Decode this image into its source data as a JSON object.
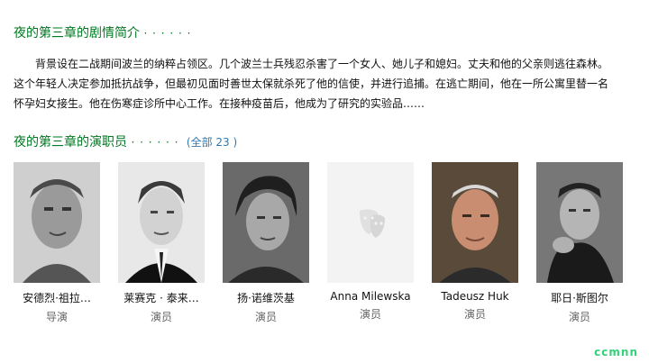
{
  "plot_section": {
    "title": "夜的第三章的剧情简介",
    "dots": "· · · · · ·",
    "summary": "背景设在二战期间波兰的纳粹占领区。几个波兰士兵残忍杀害了一个女人、她儿子和媳妇。丈夫和他的父亲则逃往森林。这个年轻人决定参加抵抗战争，但最初见面时善世太保就杀死了他的信使，并进行追捕。在逃亡期间，他在一所公寓里替一名怀孕妇女接生。他在伤寒症诊所中心工作。在接种疫苗后，他成为了研究的实验品……"
  },
  "cast_section": {
    "title": "夜的第三章的演职员",
    "dots": "· · · · · ·",
    "count_open": "(",
    "count_text": "全部 23",
    "count_close": ")",
    "members": [
      {
        "name": "安德烈·祖拉…",
        "role": "导演"
      },
      {
        "name": "莱赛克 · 泰来…",
        "role": "演员"
      },
      {
        "name": "扬·诺维茨基",
        "role": "演员"
      },
      {
        "name": "Anna Milewska",
        "role": "演员",
        "photo": "placeholder-mask-icon"
      },
      {
        "name": "Tadeusz Huk",
        "role": "演员"
      },
      {
        "name": "耶日·斯图尔",
        "role": "演员"
      }
    ]
  },
  "watermark": "ccmnn"
}
